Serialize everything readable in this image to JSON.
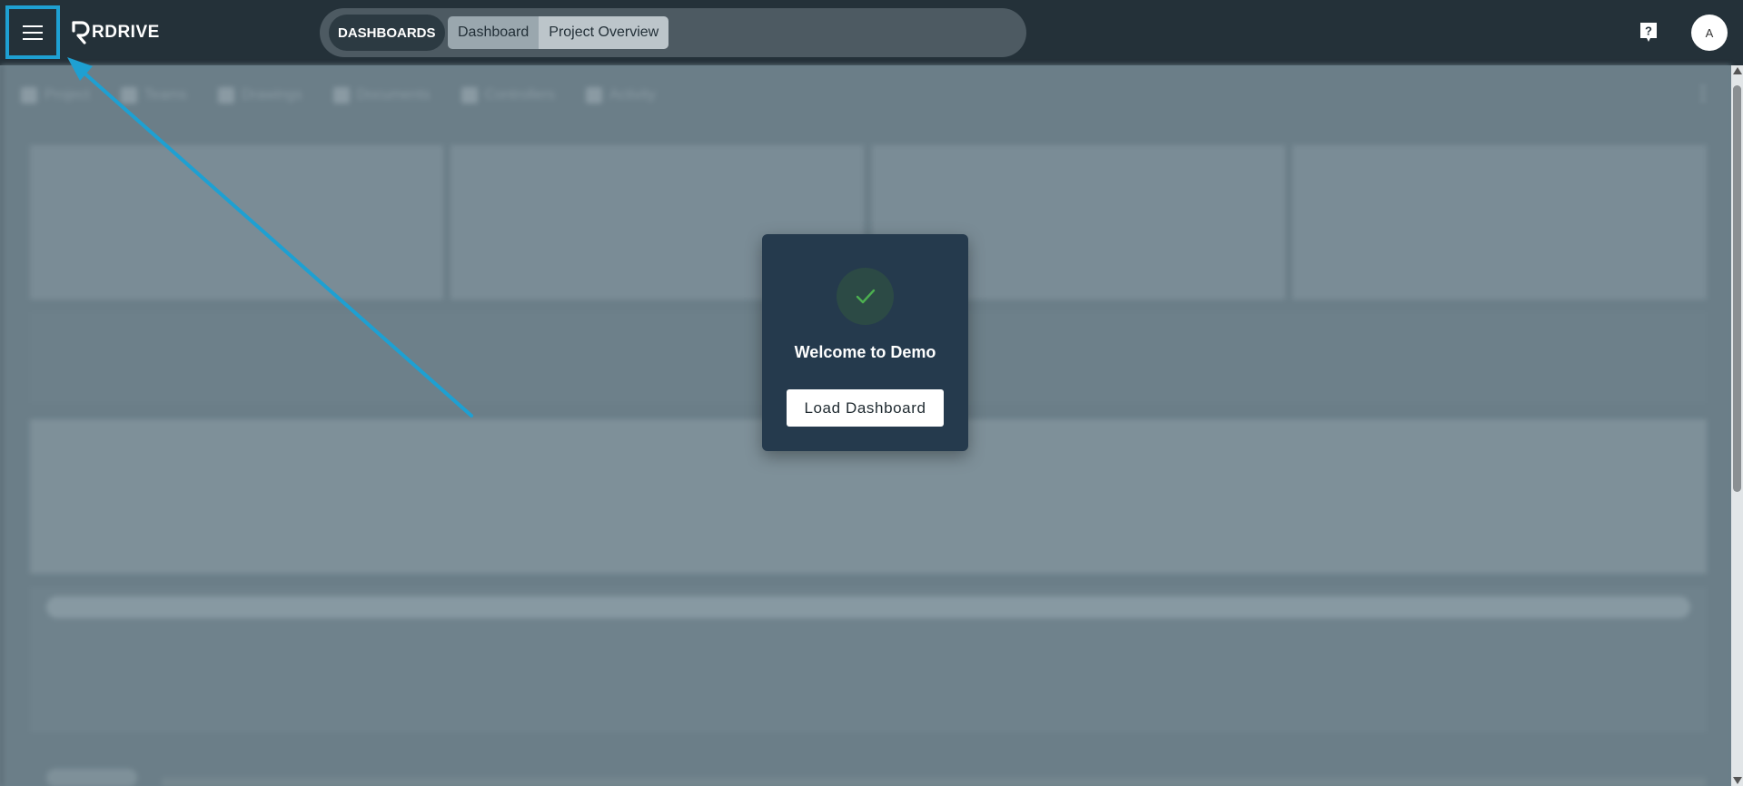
{
  "header": {
    "logo_text": "RDRIVE",
    "section_label": "DASHBOARDS",
    "breadcrumbs": [
      "Dashboard",
      "Project Overview"
    ],
    "avatar_initial": "A"
  },
  "background": {
    "subnav": [
      "Project",
      "Teams",
      "Drawings",
      "Documents",
      "Controllers",
      "Activity"
    ]
  },
  "modal": {
    "title": "Welcome to Demo",
    "button_label": "Load Dashboard"
  },
  "colors": {
    "topbar": "#243139",
    "highlight": "#1ea0d2",
    "modal_bg": "#253a4d",
    "check": "#4caf50"
  }
}
